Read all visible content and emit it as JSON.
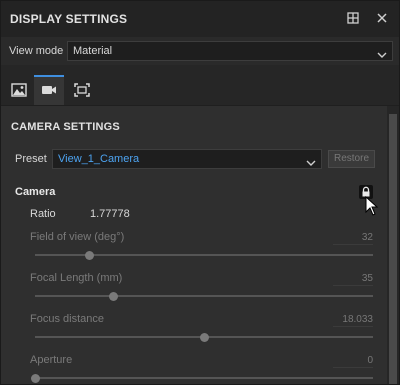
{
  "window": {
    "title": "DISPLAY SETTINGS"
  },
  "view_mode": {
    "label": "View mode",
    "value": "Material"
  },
  "tabs": [
    {
      "name": "image",
      "icon": "image-icon"
    },
    {
      "name": "camera",
      "icon": "camera-icon",
      "active": true
    },
    {
      "name": "frame",
      "icon": "frame-icon"
    }
  ],
  "camera_settings": {
    "section_title": "CAMERA SETTINGS",
    "preset_label": "Preset",
    "preset_value": "View_1_Camera",
    "restore_label": "Restore",
    "camera_title": "Camera",
    "ratio_label": "Ratio",
    "ratio_value": "1.77778",
    "params": [
      {
        "label": "Field of view (deg°)",
        "value": "32",
        "slider_fraction": 0.16
      },
      {
        "label": "Focal Length (mm)",
        "value": "35",
        "slider_fraction": 0.23
      },
      {
        "label": "Focus distance",
        "value": "18.033",
        "slider_fraction": 0.5
      },
      {
        "label": "Aperture",
        "value": "0",
        "slider_fraction": 0.0
      }
    ]
  },
  "colors": {
    "accent": "#3f8fe0",
    "link": "#4da3f0",
    "background": "#2f2f2f"
  }
}
